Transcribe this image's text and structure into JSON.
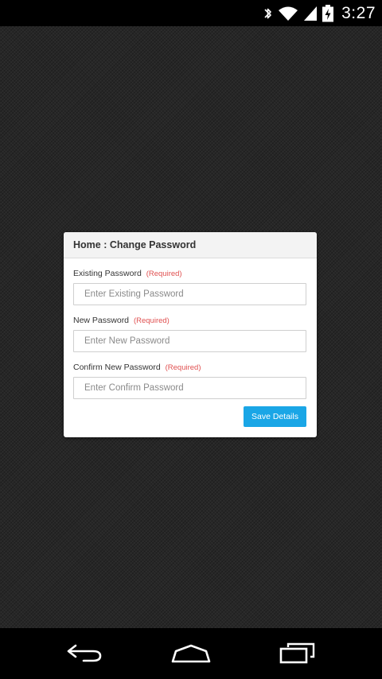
{
  "status_bar": {
    "time": "3:27",
    "icons": [
      "bluetooth-icon",
      "wifi-icon",
      "signal-icon",
      "battery-charging-icon"
    ]
  },
  "dialog": {
    "title": "Home : Change Password",
    "fields": [
      {
        "label": "Existing Password",
        "required_label": "(Required)",
        "placeholder": "Enter Existing Password",
        "value": ""
      },
      {
        "label": "New Password",
        "required_label": "(Required)",
        "placeholder": "Enter New Password",
        "value": ""
      },
      {
        "label": "Confirm New Password",
        "required_label": "(Required)",
        "placeholder": "Enter Confirm Password",
        "value": ""
      }
    ],
    "save_label": "Save Details"
  },
  "nav_bar": {
    "icons": [
      "back-icon",
      "home-icon",
      "recent-apps-icon"
    ]
  },
  "colors": {
    "accent": "#1aa6e6",
    "required": "#e05050",
    "background": "#272727",
    "bars": "#000000"
  }
}
